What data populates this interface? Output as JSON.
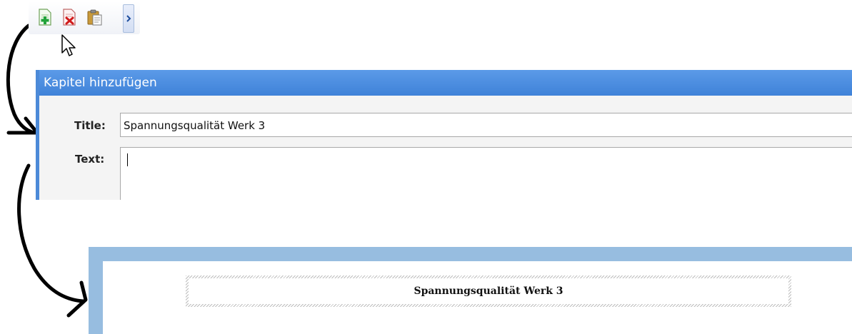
{
  "toolbar": {
    "buttons": [
      {
        "icon": "add-page-icon"
      },
      {
        "icon": "delete-page-icon"
      },
      {
        "icon": "paste-icon"
      }
    ],
    "overflow_icon": "chevron-right-icon"
  },
  "dialog": {
    "title": "Kapitel hinzufügen",
    "title_label": "Title:",
    "title_value": "Spannungsqualität Werk 3",
    "text_label": "Text:",
    "text_value": ""
  },
  "preview": {
    "heading": "Spannungsqualität Werk 3"
  },
  "colors": {
    "dialog_title_bar": "#4c8ad8",
    "preview_frame": "#97bde0"
  }
}
